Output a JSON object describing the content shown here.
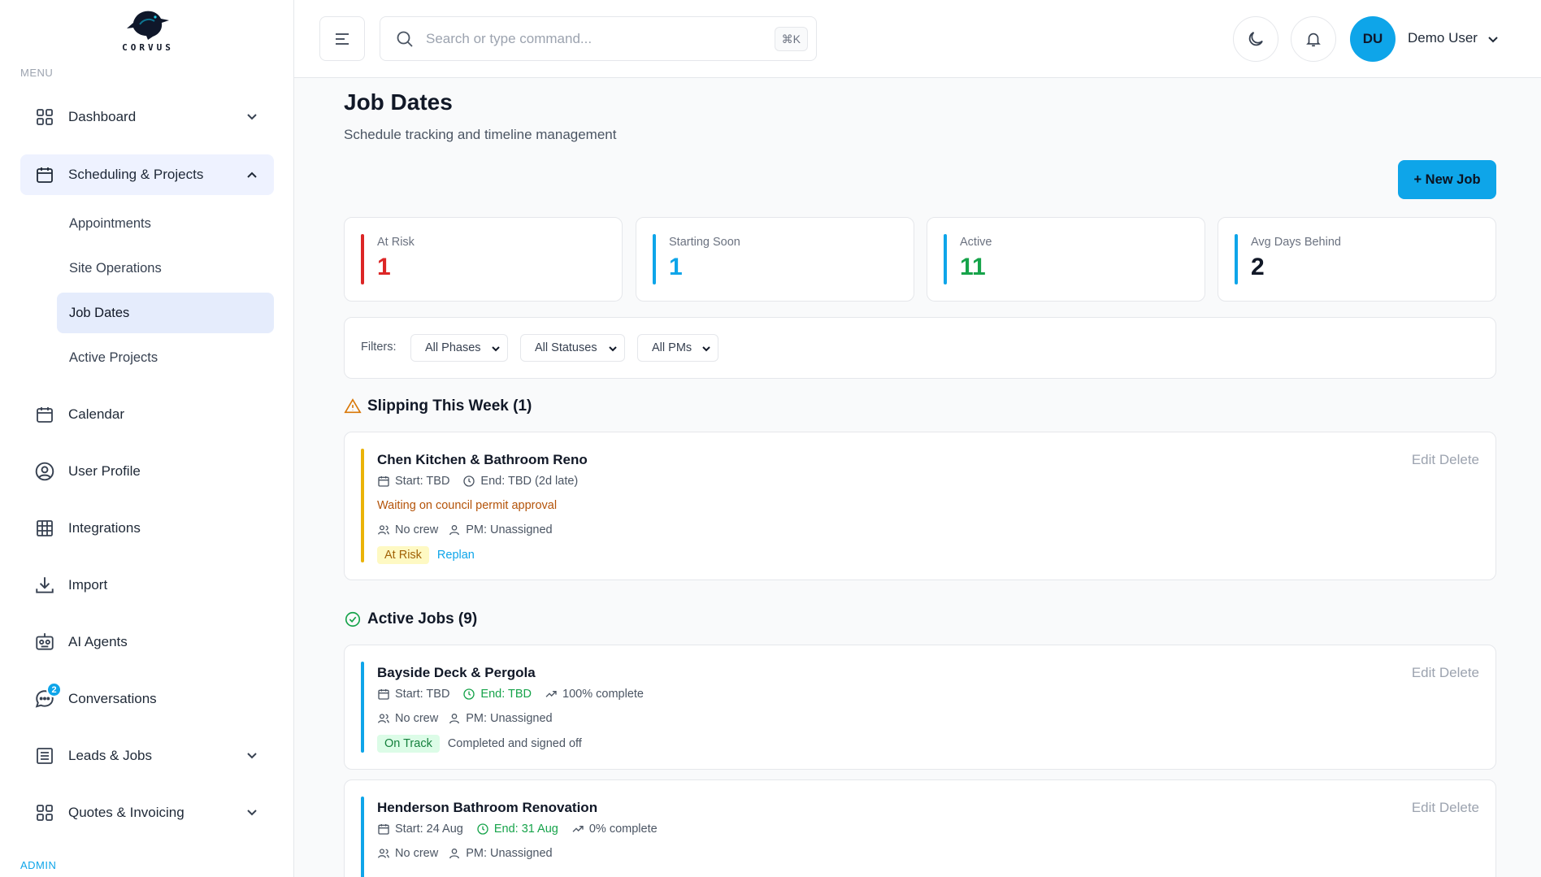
{
  "brand": {
    "name": "CORVUS"
  },
  "sidebar": {
    "menu_label": "MENU",
    "admin_label": "ADMIN",
    "items": [
      {
        "label": "Dashboard"
      },
      {
        "label": "Scheduling & Projects"
      },
      {
        "label": "Calendar"
      },
      {
        "label": "User Profile"
      },
      {
        "label": "Integrations"
      },
      {
        "label": "Import"
      },
      {
        "label": "AI Agents"
      },
      {
        "label": "Conversations",
        "badge": "2"
      },
      {
        "label": "Leads & Jobs"
      },
      {
        "label": "Quotes & Invoicing"
      }
    ],
    "sub_items": [
      {
        "label": "Appointments"
      },
      {
        "label": "Site Operations"
      },
      {
        "label": "Job Dates"
      },
      {
        "label": "Active Projects"
      }
    ]
  },
  "header": {
    "search_placeholder": "Search or type command...",
    "shortcut": "⌘K",
    "avatar_initials": "DU",
    "user_name": "Demo User"
  },
  "page": {
    "title": "Job Dates",
    "subtitle": "Schedule tracking and timeline management",
    "new_job_label": "+ New Job"
  },
  "stats": [
    {
      "label": "At Risk",
      "value": "1",
      "color": "#dc2626"
    },
    {
      "label": "Starting Soon",
      "value": "1",
      "color": "#0ea5e9"
    },
    {
      "label": "Active",
      "value": "11",
      "color": "#16a34a"
    },
    {
      "label": "Avg Days Behind",
      "value": "2",
      "color": "#0ea5e9"
    }
  ],
  "filters": {
    "label": "Filters:",
    "phase": "All Phases",
    "status": "All Statuses",
    "pm": "All PMs"
  },
  "slipping": {
    "title": "Slipping This Week (1)",
    "jobs": [
      {
        "name": "Chen Kitchen & Bathroom Reno",
        "start": "Start: TBD",
        "end": "End: TBD (2d late)",
        "note": "Waiting on council permit approval",
        "crew": "No crew",
        "pm": "PM: Unassigned",
        "tag": "At Risk",
        "action": "Replan"
      }
    ]
  },
  "active": {
    "title": "Active Jobs (9)",
    "jobs": [
      {
        "name": "Bayside Deck & Pergola",
        "start": "Start: TBD",
        "end": "End: TBD",
        "progress": "100% complete",
        "crew": "No crew",
        "pm": "PM: Unassigned",
        "tag": "On Track",
        "note": "Completed and signed off"
      },
      {
        "name": "Henderson Bathroom Renovation",
        "start": "Start: 24 Aug",
        "end": "End: 31 Aug",
        "progress": "0% complete",
        "crew": "No crew",
        "pm": "PM: Unassigned"
      }
    ]
  },
  "card_actions": {
    "edit": "Edit",
    "delete": "Delete"
  },
  "colors": {
    "accent": "#0ea5e9",
    "risk": "#eab308",
    "active": "#0ea5e9",
    "green": "#16a34a"
  }
}
